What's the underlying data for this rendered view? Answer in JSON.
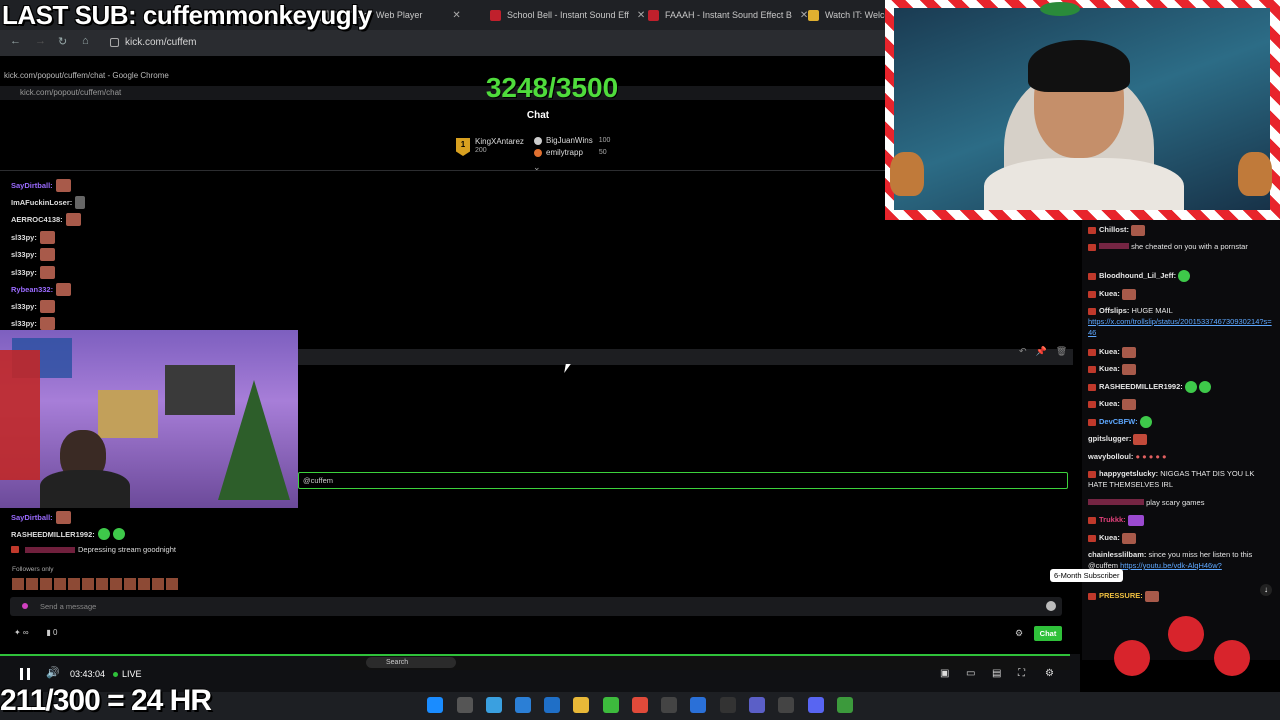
{
  "overlay": {
    "last_sub": "LAST SUB: cuffemmonkeyugly",
    "sub_goal": "3248/3500",
    "hours": "211/300 = 24 HR"
  },
  "browser": {
    "tabs": [
      {
        "label": "le Music - Web Player",
        "icon_color": "#6b6b6b"
      },
      {
        "label": "School Bell - Instant Sound Eff",
        "icon_color": "#c0202c"
      },
      {
        "label": "FAAAH - Instant Sound Effect B",
        "icon_color": "#c0202c"
      },
      {
        "label": "Watch IT: Welcom",
        "icon_color": "#e0b030"
      }
    ],
    "url": "kick.com/cuffem"
  },
  "popout": {
    "window_title": "kick.com/popout/cuffem/chat - Google Chrome",
    "url": "kick.com/popout/cuffem/chat",
    "heading": "Chat",
    "leaderboard": [
      {
        "rank": "1",
        "name": "KingXAntarez",
        "points": "200"
      },
      {
        "name": "BigJuanWins",
        "points": "100"
      },
      {
        "name": "emilytrapp",
        "points": "50"
      }
    ],
    "messages": [
      {
        "user": "SayDirtball:",
        "color": "#9b6bff"
      },
      {
        "user": "ImAFuckinLoser:",
        "color": "#dddddd"
      },
      {
        "user": "AERROC4138:",
        "color": "#dddddd"
      },
      {
        "user": "sl33py:",
        "color": "#dddddd"
      },
      {
        "user": "sl33py:",
        "color": "#dddddd"
      },
      {
        "user": "sl33py:",
        "color": "#dddddd"
      },
      {
        "user": "Rybean332:",
        "color": "#9b6bff"
      },
      {
        "user": "sl33py:",
        "color": "#dddddd"
      },
      {
        "user": "sl33py:",
        "color": "#dddddd"
      }
    ],
    "reply_mention": "@cuffem",
    "lower_messages": [
      {
        "user": "SayDirtball:",
        "color": "#9b6bff",
        "text": ""
      },
      {
        "user": "RASHEEDMILLER1992:",
        "color": "#dddddd",
        "text": ""
      },
      {
        "user": "",
        "color": "#e0407a",
        "text": "Depressing stream goodnight"
      }
    ],
    "followers_only": "Followers only",
    "send_placeholder": "Send a message",
    "chat_button": "Chat",
    "counter": "0"
  },
  "player": {
    "time": "03:43:04",
    "live": "LIVE",
    "inner_search": "Search"
  },
  "right_chat": {
    "messages": [
      {
        "user": "Chillost:",
        "color": "#ffffff",
        "text": ""
      },
      {
        "user": "",
        "color": "#e0407a",
        "text": "she cheated on you with a pornstar"
      },
      {
        "user": "Bloodhound_Lil_Jeff:",
        "color": "#ffffff",
        "text": ""
      },
      {
        "user": "Kuea:",
        "color": "#ffffff",
        "text": ""
      },
      {
        "user": "Offslips:",
        "color": "#ffffff",
        "text": "HUGE MAIL",
        "link": "https://x.com/trollslip/status/2001533746730930214?s=46"
      },
      {
        "user": "Kuea:",
        "color": "#ffffff",
        "text": ""
      },
      {
        "user": "Kuea:",
        "color": "#ffffff",
        "text": ""
      },
      {
        "user": "RASHEEDMILLER1992:",
        "color": "#ffffff",
        "text": ""
      },
      {
        "user": "Kuea:",
        "color": "#ffffff",
        "text": ""
      },
      {
        "user": "DevCBFW:",
        "color": "#5ea8ff",
        "text": ""
      },
      {
        "user": "gpitslugger:",
        "color": "#ffffff",
        "text": ""
      },
      {
        "user": "wavybolloul:",
        "color": "#ffffff",
        "text": ""
      },
      {
        "user": "happygetslucky:",
        "color": "#ffffff",
        "text": "NIGGAS THAT DIS YOU LK HATE THEMSELVES IRL"
      },
      {
        "user": "",
        "color": "#e0407a",
        "text": "play scary games"
      },
      {
        "user": "Trukkk:",
        "color": "#e0407a",
        "text": ""
      },
      {
        "user": "Kuea:",
        "color": "#ffffff",
        "text": ""
      },
      {
        "user": "chainlesslilbam:",
        "color": "#ffffff",
        "text": "since you miss her listen to this @cuffem",
        "link": "https://youtu.be/vdk-AlqH46w?"
      },
      {
        "user": "PRESSURE:",
        "color": "#f0c040",
        "text": ""
      }
    ],
    "tooltip": "6-Month Subscriber"
  }
}
